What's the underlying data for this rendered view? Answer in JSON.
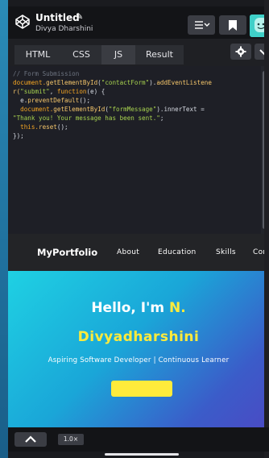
{
  "project": {
    "title": "Untitled",
    "author": "Divya Dharshini"
  },
  "tabs": [
    {
      "label": "HTML"
    },
    {
      "label": "CSS"
    },
    {
      "label": "JS"
    },
    {
      "label": "Result"
    }
  ],
  "code": {
    "line1": "// Form Submission",
    "line2_a": "document.",
    "line2_b": "getElementById",
    "line2_c": "(",
    "line2_d": "\"contactForm\"",
    "line2_e": ").",
    "line2_f": "addEventListene",
    "line3_a": "r(",
    "line3_b": "\"submit\"",
    "line3_c": ", ",
    "line3_d": "function",
    "line3_e": "(e) {",
    "line4_a": "  e.",
    "line4_b": "preventDefault",
    "line4_c": "();",
    "line5_a": "  document.",
    "line5_b": "getElementById",
    "line5_c": "(",
    "line5_d": "\"formMessage\"",
    "line5_e": ").innerText =",
    "line6": "\"Thank you! Your message has been sent.\"",
    "line6_end": ";",
    "line7_a": "  this.",
    "line7_b": "reset",
    "line7_c": "();",
    "line8": "});"
  },
  "preview": {
    "brand": "MyPortfolio",
    "nav": [
      "About",
      "Education",
      "Skills",
      "Con"
    ],
    "hello": "Hello, I'm ",
    "initial": "N.",
    "name": "Divyadharshini",
    "tagline": "Aspiring Software Developer | Continuous Learner"
  },
  "bottom": {
    "zoom": "1.0×"
  },
  "colors": {
    "accent": "#ffeb3b",
    "hero_start": "#1fd1e3",
    "hero_end": "#4a4bc4"
  }
}
